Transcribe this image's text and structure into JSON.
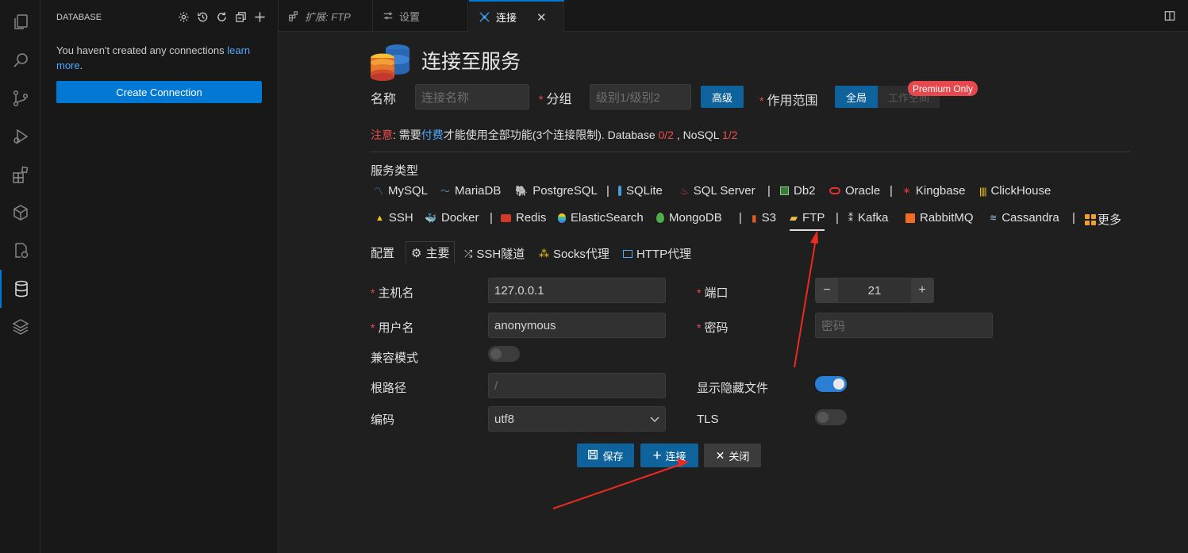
{
  "sidebar": {
    "title": "DATABASE",
    "empty_message": "You haven't created any connections ",
    "learn_more": "learn more",
    "period": ".",
    "create_button": "Create Connection"
  },
  "tabs": [
    {
      "label": "扩展: FTP"
    },
    {
      "label": "设置"
    },
    {
      "label": "连接"
    }
  ],
  "header": {
    "title": "连接至服务"
  },
  "form": {
    "name_label": "名称",
    "name_placeholder": "连接名称",
    "group_label": "分组",
    "group_placeholder": "级别1/级别2",
    "advanced_button": "高级",
    "scope_label": "作用范围",
    "scope_global": "全局",
    "scope_workspace": "工作空间",
    "premium_badge": "Premium Only"
  },
  "notice": {
    "prefix": "注意",
    "colon": ": 需要",
    "link": "付费",
    "text": "才能使用全部功能(3个连接限制). Database ",
    "db_count": "0/2",
    "mid": " , NoSQL ",
    "nosql_count": "1/2"
  },
  "service_type_label": "服务类型",
  "services_row1": [
    "MySQL",
    "MariaDB",
    "PostgreSQL",
    "SQLite",
    "SQL Server",
    "Db2",
    "Oracle",
    "Kingbase",
    "ClickHouse"
  ],
  "services_row2": [
    "SSH",
    "Docker",
    "Redis",
    "ElasticSearch",
    "MongoDB",
    "S3",
    "FTP",
    "Kafka",
    "RabbitMQ",
    "Cassandra",
    "更多"
  ],
  "config": {
    "label": "配置",
    "tabs": [
      "主要",
      "SSH隧道",
      "Socks代理",
      "HTTP代理"
    ]
  },
  "fields": {
    "host_label": "主机名",
    "host_value": "127.0.0.1",
    "port_label": "端口",
    "port_value": "21",
    "user_label": "用户名",
    "user_value": "anonymous",
    "password_label": "密码",
    "password_placeholder": "密码",
    "compat_label": "兼容模式",
    "root_label": "根路径",
    "root_placeholder": "/",
    "hidden_label": "显示隐藏文件",
    "encoding_label": "编码",
    "encoding_value": "utf8",
    "tls_label": "TLS"
  },
  "actions": {
    "save": "保存",
    "connect": "连接",
    "close": "关闭"
  },
  "colors": {
    "accent": "#0e639c",
    "required": "#f14c4c",
    "premium": "#e5484d",
    "arrow": "#ee2a1f"
  }
}
